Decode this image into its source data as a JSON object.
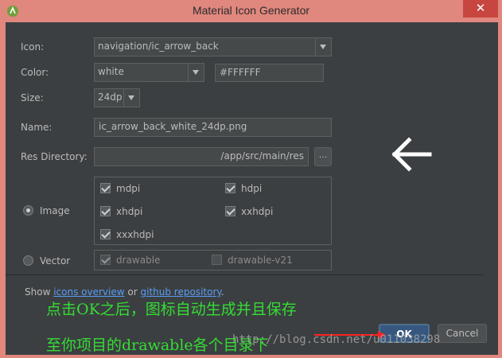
{
  "window": {
    "title": "Material Icon Generator",
    "close_glyph": "✕"
  },
  "form": {
    "icon_label": "Icon:",
    "icon_value": "navigation/ic_arrow_back",
    "color_label": "Color:",
    "color_value": "white",
    "color_hex": "#FFFFFF",
    "size_label": "Size:",
    "size_value": "24dp",
    "name_label": "Name:",
    "name_value": "ic_arrow_back_white_24dp.png",
    "resdir_label": "Res Directory:",
    "resdir_value": "/app/src/main/res",
    "browse_label": "..."
  },
  "image_option": {
    "label": "Image",
    "selected": true,
    "densities": [
      {
        "label": "mdpi",
        "checked": true
      },
      {
        "label": "hdpi",
        "checked": true
      },
      {
        "label": "xhdpi",
        "checked": true
      },
      {
        "label": "xxhdpi",
        "checked": true
      },
      {
        "label": "xxxhdpi",
        "checked": true
      }
    ]
  },
  "vector_option": {
    "label": "Vector",
    "selected": false,
    "options": [
      {
        "label": "drawable",
        "checked": true
      },
      {
        "label": "drawable-v21",
        "checked": false
      }
    ]
  },
  "footer": {
    "show_text": "Show",
    "link_icons": "icons overview",
    "or_text": "or",
    "link_github": "github repository",
    "period": "."
  },
  "buttons": {
    "ok": "OK",
    "cancel": "Cancel"
  },
  "annotations": {
    "line1": "点击OK之后，图标自动生成并且保存",
    "line2": "至你项目的drawable各个目录下",
    "watermark": "http://blog.csdn.net/u011038298"
  },
  "colors": {
    "annotation": "#33dd33",
    "arrow": "#ffffff",
    "red_arrow": "#ff2222",
    "link": "#589df6"
  }
}
